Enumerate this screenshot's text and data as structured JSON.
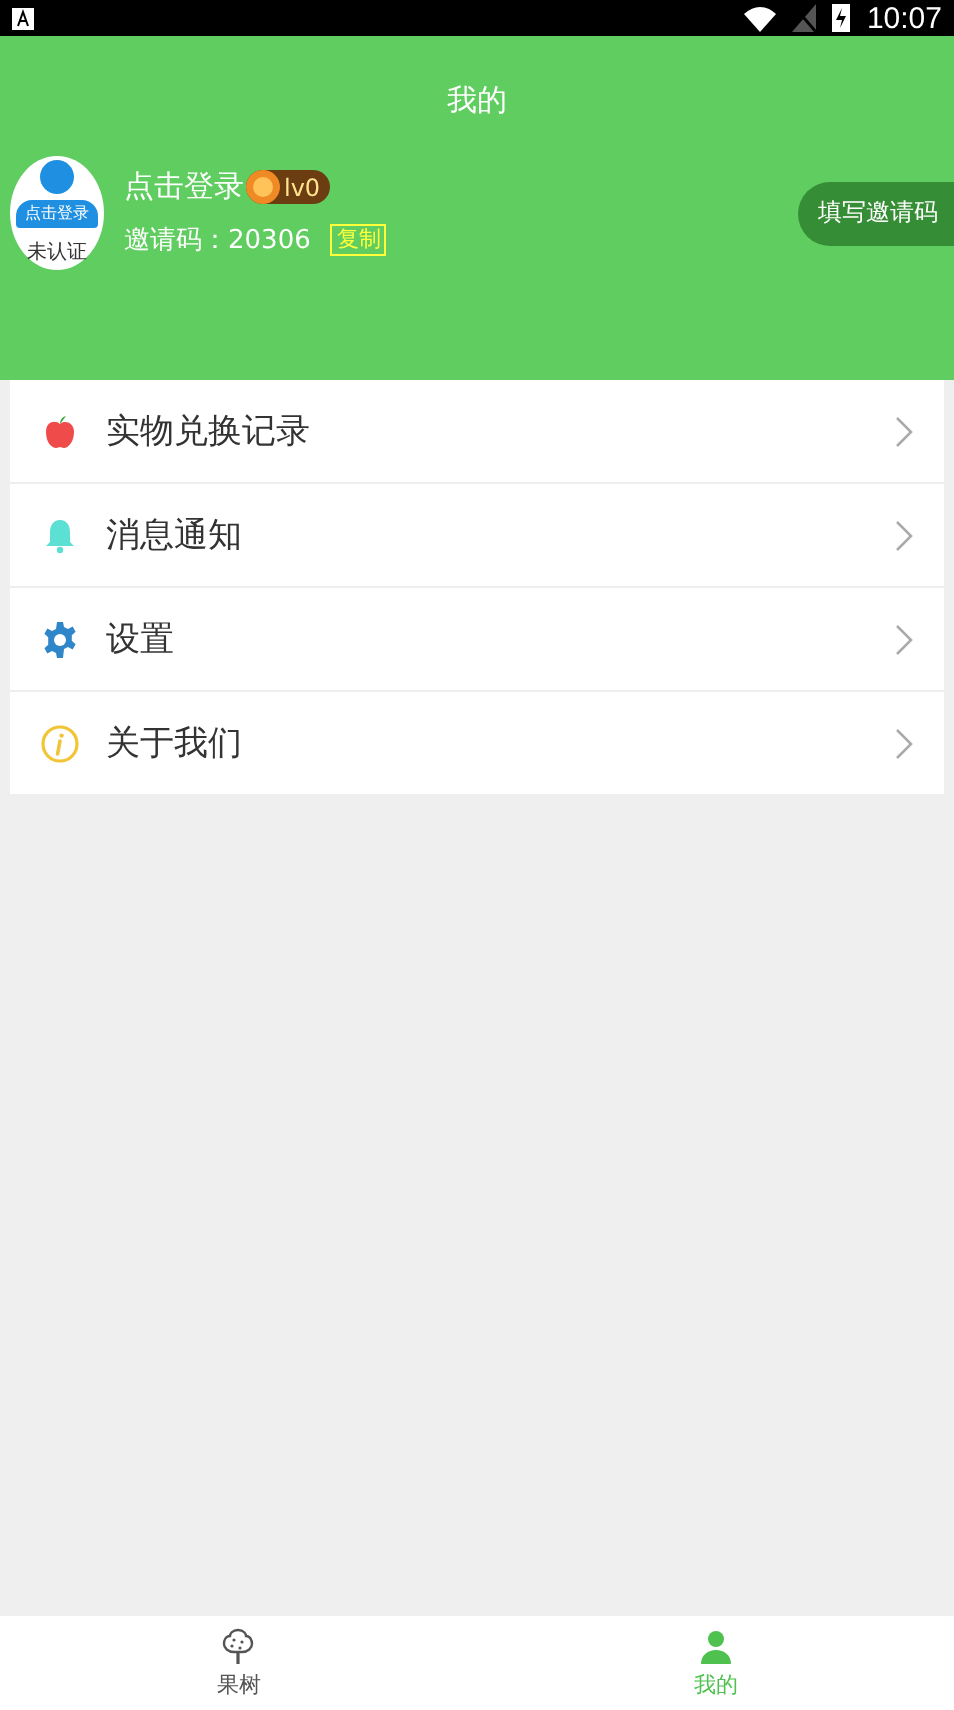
{
  "status_bar": {
    "time": "10:07"
  },
  "header": {
    "title": "我的",
    "avatar_caption": "点击登录",
    "avatar_badge": "未认证",
    "login_label": "点击登录",
    "level": "lv0",
    "invite_label": "邀请码：20306",
    "copy_button": "复制",
    "invite_button": "填写邀请码"
  },
  "menu": [
    {
      "kind": "apple",
      "label": "实物兑换记录"
    },
    {
      "kind": "bell",
      "label": "消息通知"
    },
    {
      "kind": "gear",
      "label": "设置"
    },
    {
      "kind": "info",
      "label": "关于我们"
    }
  ],
  "tabs": [
    {
      "kind": "tree",
      "label": "果树",
      "selected": false
    },
    {
      "kind": "person",
      "label": "我的",
      "selected": true
    }
  ]
}
